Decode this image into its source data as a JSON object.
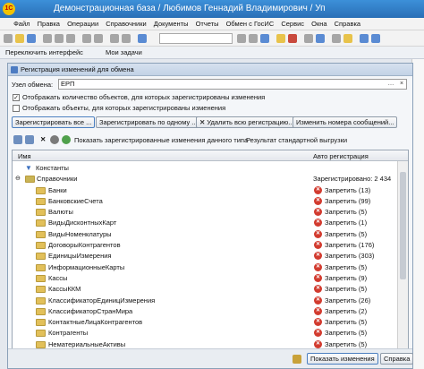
{
  "window": {
    "logo_text": "1С",
    "title": "Демонстрационная база / Любимов Геннадий Владимирович / Уп"
  },
  "menu": [
    "Файл",
    "Правка",
    "Операции",
    "Справочники",
    "Документы",
    "Отчеты",
    "Обмен с ГосИС",
    "Сервис",
    "Окна",
    "Справка"
  ],
  "panel": {
    "switch_interface": "Переключить интерфейс",
    "my_tasks": "Мои задачи"
  },
  "dialog": {
    "title": "Регистрация изменений для обмена",
    "node_label": "Узел обмена:",
    "node_value": "ЕРП",
    "show_counts_label": "Отображать количество объектов, для которых зарегистрированы изменения",
    "show_counts_checked": true,
    "show_objects_label": "Отображать объекты, для которых зарегистрированы изменения",
    "show_objects_checked": false,
    "buttons": {
      "register_all": "Зарегистрировать все ...",
      "register_one": "Зарегистрировать по одному ...",
      "delete_all": "Удалить всю регистрацию...",
      "change_number": "Изменить номера сообщений..."
    },
    "toolbar2": {
      "show_changes": "Показать зарегистрированные изменения данного типа",
      "upload_result": "Результат стандартной выгрузки"
    },
    "table": {
      "col_name": "Имя",
      "col_reg": "Авто регистрация",
      "constants": "Константы",
      "catalogs": "Справочники",
      "catalogs_reg": "Зарегистрировано: 2 434",
      "rows": [
        {
          "name": "Банки",
          "reg": "Запретить (13)"
        },
        {
          "name": "БанковскиеСчета",
          "reg": "Запретить (99)"
        },
        {
          "name": "Валюты",
          "reg": "Запретить (5)"
        },
        {
          "name": "ВидыДисконтныхКарт",
          "reg": "Запретить (1)"
        },
        {
          "name": "ВидыНоменклатуры",
          "reg": "Запретить (5)"
        },
        {
          "name": "ДоговорыКонтрагентов",
          "reg": "Запретить (176)"
        },
        {
          "name": "ЕдиницыИзмерения",
          "reg": "Запретить (303)"
        },
        {
          "name": "ИнформационныеКарты",
          "reg": "Запретить (5)"
        },
        {
          "name": "Кассы",
          "reg": "Запретить (9)"
        },
        {
          "name": "КассыККМ",
          "reg": "Запретить (5)"
        },
        {
          "name": "КлассификаторЕдиницИзмерения",
          "reg": "Запретить (26)"
        },
        {
          "name": "КлассификаторСтранМира",
          "reg": "Запретить (2)"
        },
        {
          "name": "КонтактныеЛицаКонтрагентов",
          "reg": "Запретить (5)"
        },
        {
          "name": "Контрагенты",
          "reg": "Запретить (5)"
        },
        {
          "name": "НематериальныеАктивы",
          "reg": "Запретить (5)"
        }
      ]
    },
    "status": {
      "show_changes_button": "Показать изменения",
      "help": "Справка"
    }
  }
}
